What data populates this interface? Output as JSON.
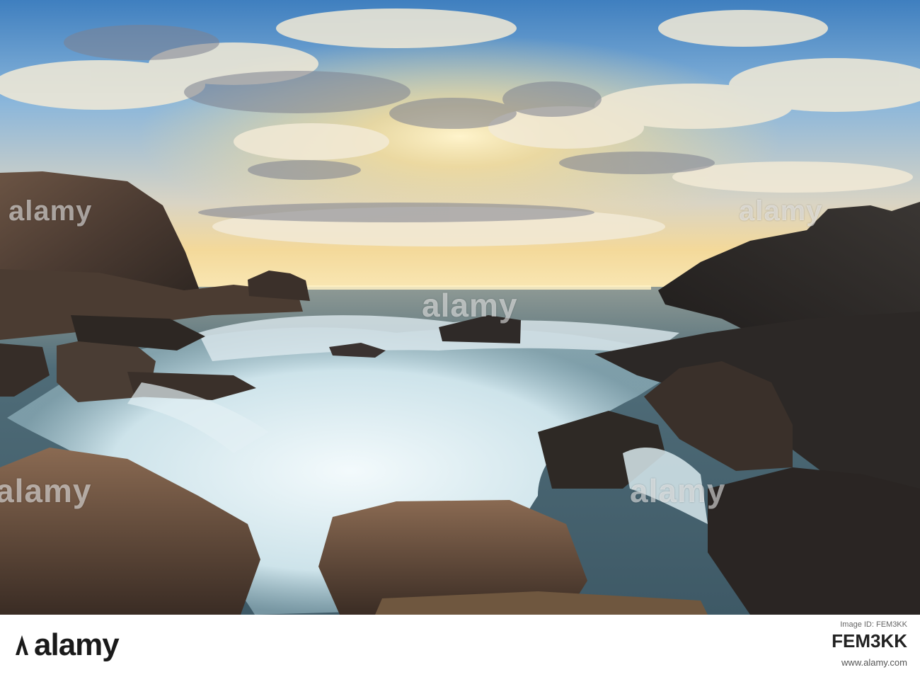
{
  "photo": {
    "subject": "rocky-coast-sunset-waves",
    "colors": {
      "sky_blue": "#6fa3cf",
      "sun_glow": "#f6d98a",
      "rock_dark": "#2a2624",
      "rock_warm": "#7a5d47",
      "foam": "#e6f1f5",
      "sea": "#4d6f7d"
    }
  },
  "watermark": {
    "text": "alamy"
  },
  "footer": {
    "logo": "alamy",
    "image_id_label": "Image ID: FEM3KK",
    "image_code": "FEM3KK",
    "site": "www.alamy.com"
  }
}
